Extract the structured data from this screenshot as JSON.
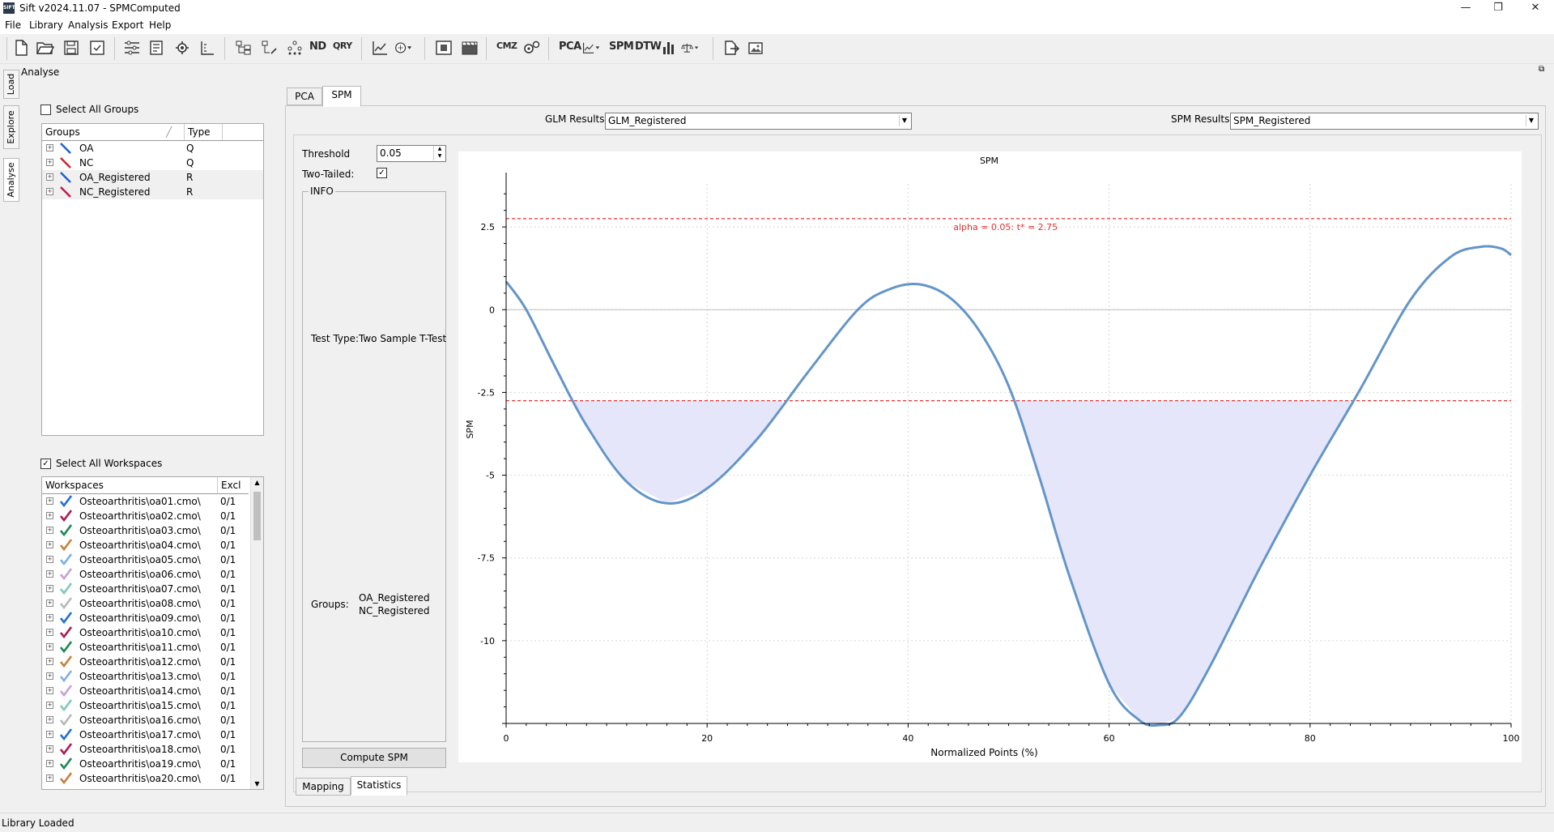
{
  "window": {
    "title": "Sift v2024.11.07 - SPMComputed",
    "app_icon_label": "SIFT",
    "controls": [
      "—",
      "❐",
      "✕"
    ]
  },
  "menu": [
    "File",
    "Library",
    "Analysis",
    "Export",
    "Help"
  ],
  "toolbar": {
    "text_buttons": [
      "ND",
      "QRY",
      "CMZ",
      "PCA",
      "SPM",
      "DTW"
    ]
  },
  "side_tabs": [
    "Load",
    "Explore",
    "Analyse"
  ],
  "section_title": "Analyse",
  "groups_panel": {
    "select_all_label": "Select All Groups",
    "select_all_checked": false,
    "columns": [
      "Groups",
      "Type"
    ],
    "rows": [
      {
        "name": "OA",
        "type": "Q",
        "color": "#1f5fc8"
      },
      {
        "name": "NC",
        "type": "Q",
        "color": "#d0202a"
      },
      {
        "name": "OA_Registered",
        "type": "R",
        "color": "#1f5fc8"
      },
      {
        "name": "NC_Registered",
        "type": "R",
        "color": "#c01848"
      }
    ]
  },
  "workspaces_panel": {
    "select_all_label": "Select All Workspaces",
    "select_all_checked": true,
    "columns": [
      "Workspaces",
      "Excl"
    ],
    "rows": [
      {
        "name": "Osteoarthritis\\oa01.cmo\\",
        "excl": "0/1",
        "color": "#1f6fd0"
      },
      {
        "name": "Osteoarthritis\\oa02.cmo\\",
        "excl": "0/1",
        "color": "#b01850"
      },
      {
        "name": "Osteoarthritis\\oa03.cmo\\",
        "excl": "0/1",
        "color": "#1a8a50"
      },
      {
        "name": "Osteoarthritis\\oa04.cmo\\",
        "excl": "0/1",
        "color": "#c8803a"
      },
      {
        "name": "Osteoarthritis\\oa05.cmo\\",
        "excl": "0/1",
        "color": "#7fb0e0"
      },
      {
        "name": "Osteoarthritis\\oa06.cmo\\",
        "excl": "0/1",
        "color": "#c8a0d8"
      },
      {
        "name": "Osteoarthritis\\oa07.cmo\\",
        "excl": "0/1",
        "color": "#80c8b8"
      },
      {
        "name": "Osteoarthritis\\oa08.cmo\\",
        "excl": "0/1",
        "color": "#b8b8b8"
      },
      {
        "name": "Osteoarthritis\\oa09.cmo\\",
        "excl": "0/1",
        "color": "#1f6fd0"
      },
      {
        "name": "Osteoarthritis\\oa10.cmo\\",
        "excl": "0/1",
        "color": "#b01850"
      },
      {
        "name": "Osteoarthritis\\oa11.cmo\\",
        "excl": "0/1",
        "color": "#1a8a50"
      },
      {
        "name": "Osteoarthritis\\oa12.cmo\\",
        "excl": "0/1",
        "color": "#c8803a"
      },
      {
        "name": "Osteoarthritis\\oa13.cmo\\",
        "excl": "0/1",
        "color": "#7fb0e0"
      },
      {
        "name": "Osteoarthritis\\oa14.cmo\\",
        "excl": "0/1",
        "color": "#c8a0d8"
      },
      {
        "name": "Osteoarthritis\\oa15.cmo\\",
        "excl": "0/1",
        "color": "#80c8b8"
      },
      {
        "name": "Osteoarthritis\\oa16.cmo\\",
        "excl": "0/1",
        "color": "#b8b8b8"
      },
      {
        "name": "Osteoarthritis\\oa17.cmo\\",
        "excl": "0/1",
        "color": "#1f6fd0"
      },
      {
        "name": "Osteoarthritis\\oa18.cmo\\",
        "excl": "0/1",
        "color": "#b01850"
      },
      {
        "name": "Osteoarthritis\\oa19.cmo\\",
        "excl": "0/1",
        "color": "#1a8a50"
      },
      {
        "name": "Osteoarthritis\\oa20.cmo\\",
        "excl": "0/1",
        "color": "#c8803a"
      }
    ]
  },
  "analysis_tabs": [
    "PCA",
    "SPM"
  ],
  "active_analysis_tab": "SPM",
  "glm": {
    "label": "GLM Results:",
    "value": "GLM_Registered"
  },
  "spm_results": {
    "label": "SPM Results:",
    "value": "SPM_Registered"
  },
  "settings": {
    "threshold_label": "Threshold",
    "threshold_value": "0.05",
    "two_tailed_label": "Two-Tailed:",
    "two_tailed_checked": true,
    "info_label": "INFO",
    "test_type_label": "Test Type:",
    "test_type_value": "Two Sample T-Test",
    "groups_label": "Groups:",
    "groups_values": [
      "OA_Registered",
      "NC_Registered"
    ],
    "compute_button": "Compute SPM"
  },
  "bottom_tabs": [
    "Mapping",
    "Statistics"
  ],
  "active_bottom_tab": "Statistics",
  "status": "Library Loaded",
  "chart_data": {
    "type": "line",
    "title": "SPM",
    "xlabel": "Normalized Points (%)",
    "ylabel": "SPM",
    "xlim": [
      0,
      100
    ],
    "ylim": [
      -12.5,
      3.8
    ],
    "xticks": [
      0,
      20,
      40,
      60,
      80,
      100
    ],
    "yticks": [
      2.5,
      0,
      -2.5,
      -5,
      -7.5,
      -10
    ],
    "ytick_labels": [
      "2.5",
      "0",
      "-2.5",
      "-5",
      "-7.5",
      "-10"
    ],
    "grid": true,
    "threshold": 2.75,
    "annotation": "alpha = 0.05: t* = 2.75",
    "colors": {
      "line": "#6395c9",
      "threshold": "#e83030",
      "fill": "#e6e6fa"
    },
    "series": [
      {
        "x": [
          0,
          2,
          5,
          8,
          12,
          16,
          20,
          25,
          30,
          35,
          38,
          41,
          44,
          47,
          50,
          53,
          56,
          60,
          63,
          65,
          67,
          70,
          75,
          80,
          85,
          90,
          94,
          97,
          99,
          100
        ],
        "values": [
          0.85,
          0.0,
          -1.8,
          -3.5,
          -5.2,
          -5.85,
          -5.4,
          -3.9,
          -1.9,
          0.0,
          0.6,
          0.77,
          0.4,
          -0.6,
          -2.3,
          -5.0,
          -8.0,
          -11.3,
          -12.4,
          -12.55,
          -12.3,
          -10.8,
          -7.8,
          -5.0,
          -2.4,
          0.3,
          1.6,
          1.9,
          1.85,
          1.65
        ]
      }
    ]
  }
}
